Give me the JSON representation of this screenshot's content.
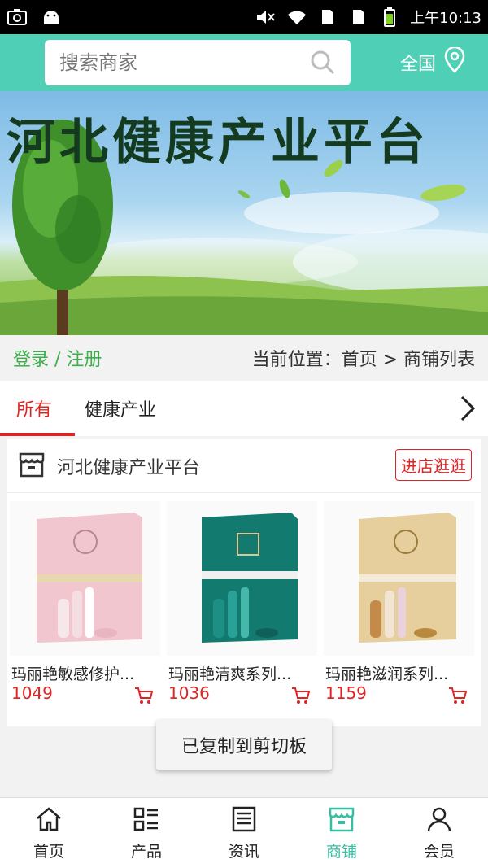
{
  "status_bar": {
    "time": "上午10:13"
  },
  "header": {
    "search": {
      "placeholder": "搜索商家"
    },
    "region": {
      "label": "全国"
    }
  },
  "banner": {
    "title": "河北健康产业平台"
  },
  "crumb": {
    "login_label": "登录 / 注册",
    "location": "当前位置：首页 > 商铺列表"
  },
  "tabs": [
    {
      "label": "所有",
      "active": true
    },
    {
      "label": "健康产业",
      "active": false
    }
  ],
  "shop": {
    "name": "河北健康产业平台",
    "enter_label": "进店逛逛",
    "products": [
      {
        "name": "玛丽艳敏感修护...",
        "price": "1049",
        "box_color": "#f2c6cf"
      },
      {
        "name": "玛丽艳清爽系列...",
        "price": "1036",
        "box_color": "#137a70"
      },
      {
        "name": "玛丽艳滋润系列...",
        "price": "1159",
        "box_color": "#e6cf9c"
      }
    ]
  },
  "toast": {
    "text": "已复制到剪切板"
  },
  "bottom_nav": [
    {
      "label": "首页",
      "icon": "home-icon"
    },
    {
      "label": "产品",
      "icon": "products-icon"
    },
    {
      "label": "资讯",
      "icon": "news-icon"
    },
    {
      "label": "商铺",
      "icon": "shop-icon",
      "active": true
    },
    {
      "label": "会员",
      "icon": "member-icon"
    }
  ],
  "colors": {
    "accent": "#4fd0b6",
    "price": "#e02424",
    "login": "#3cae4a"
  }
}
